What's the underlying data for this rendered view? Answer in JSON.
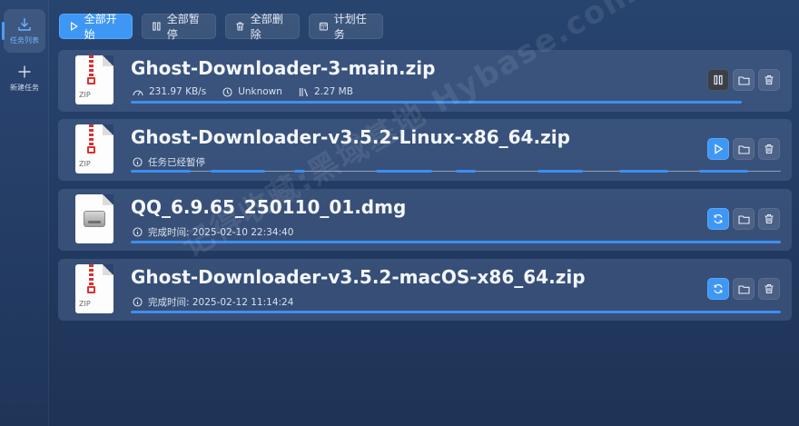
{
  "sidebar": {
    "items": [
      {
        "label": "任务列表",
        "icon": "download-icon",
        "active": true
      },
      {
        "label": "新建任务",
        "icon": "plus-icon",
        "active": false
      }
    ]
  },
  "toolbar": {
    "start_all": "全部开始",
    "pause_all": "全部暂停",
    "delete_all": "全部删除",
    "schedule": "计划任务"
  },
  "tasks": [
    {
      "name": "Ghost-Downloader-3-main.zip",
      "file_type": "ZIP",
      "speed": "231.97 KB/s",
      "eta": "Unknown",
      "size": "2.27 MB",
      "state": "downloading",
      "progress": 0.94,
      "action": "pause-icon"
    },
    {
      "name": "Ghost-Downloader-v3.5.2-Linux-x86_64.zip",
      "file_type": "ZIP",
      "status": "任务已经暂停",
      "state": "paused",
      "action": "play-icon"
    },
    {
      "name": "QQ_6.9.65_250110_01.dmg",
      "file_type": "DMG",
      "status": "完成时间: 2025-02-10 22:34:40",
      "state": "completed",
      "progress": 1.0,
      "action": "refresh-icon"
    },
    {
      "name": "Ghost-Downloader-v3.5.2-macOS-x86_64.zip",
      "file_type": "ZIP",
      "status": "完成时间: 2025-02-12 11:14:24",
      "state": "completed",
      "progress": 1.0,
      "action": "refresh-icon"
    }
  ],
  "watermark": "记得收藏:黑域基地 Hybase.com",
  "colors": {
    "accent": "#3f97f5",
    "background": "#233c63"
  }
}
